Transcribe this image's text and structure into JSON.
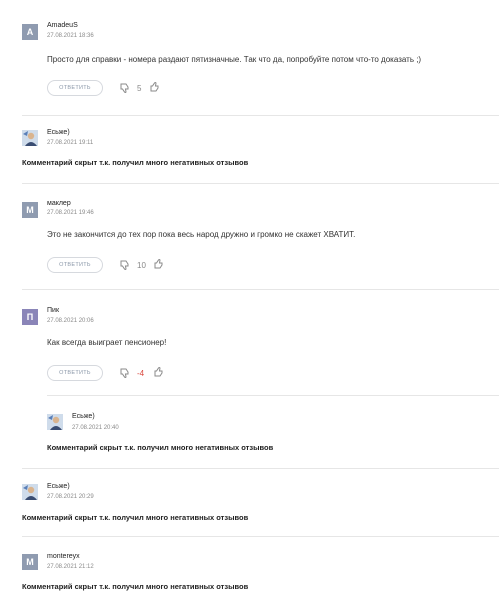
{
  "icons": {
    "thumb_down": "thumb-down-icon",
    "thumb_up": "thumb-up-icon"
  },
  "colors": {
    "negative_votes": "#d9453b",
    "avatar_grey": "#8f9bb0",
    "avatar_purple": "#8a85b8"
  },
  "hidden_message": "Комментарий скрыт т.к. получил много негативных отзывов",
  "reply_label": "ОТВЕТИТЬ",
  "comments": [
    {
      "author": "AmadeuS",
      "avatar_letter": "A",
      "date": "27.08.2021 18:36",
      "text": "Просто для справки - номера раздают пятизначные. Так что да, попробуйте потом что-то доказать ;)",
      "votes": "5"
    },
    {
      "author": "Есьже)",
      "avatar_letter": "",
      "date": "27.08.2021 19:11",
      "text": "",
      "votes": ""
    },
    {
      "author": "маклер",
      "avatar_letter": "М",
      "date": "27.08.2021 19:46",
      "text": "Это не закончится до тех пор пока весь народ дружно и громко не скажет ХВАТИТ.",
      "votes": "10"
    },
    {
      "author": "Пик",
      "avatar_letter": "П",
      "date": "27.08.2021 20:06",
      "text": "Как всегда выиграет пенсионер!",
      "votes": "-4"
    },
    {
      "author": "Есьже)",
      "avatar_letter": "",
      "date": "27.08.2021 20:40",
      "text": "",
      "votes": ""
    },
    {
      "author": "Есьже)",
      "avatar_letter": "",
      "date": "27.08.2021 20:29",
      "text": "",
      "votes": ""
    },
    {
      "author": "montereyx",
      "avatar_letter": "М",
      "date": "27.08.2021 21:12",
      "text": "",
      "votes": ""
    }
  ]
}
